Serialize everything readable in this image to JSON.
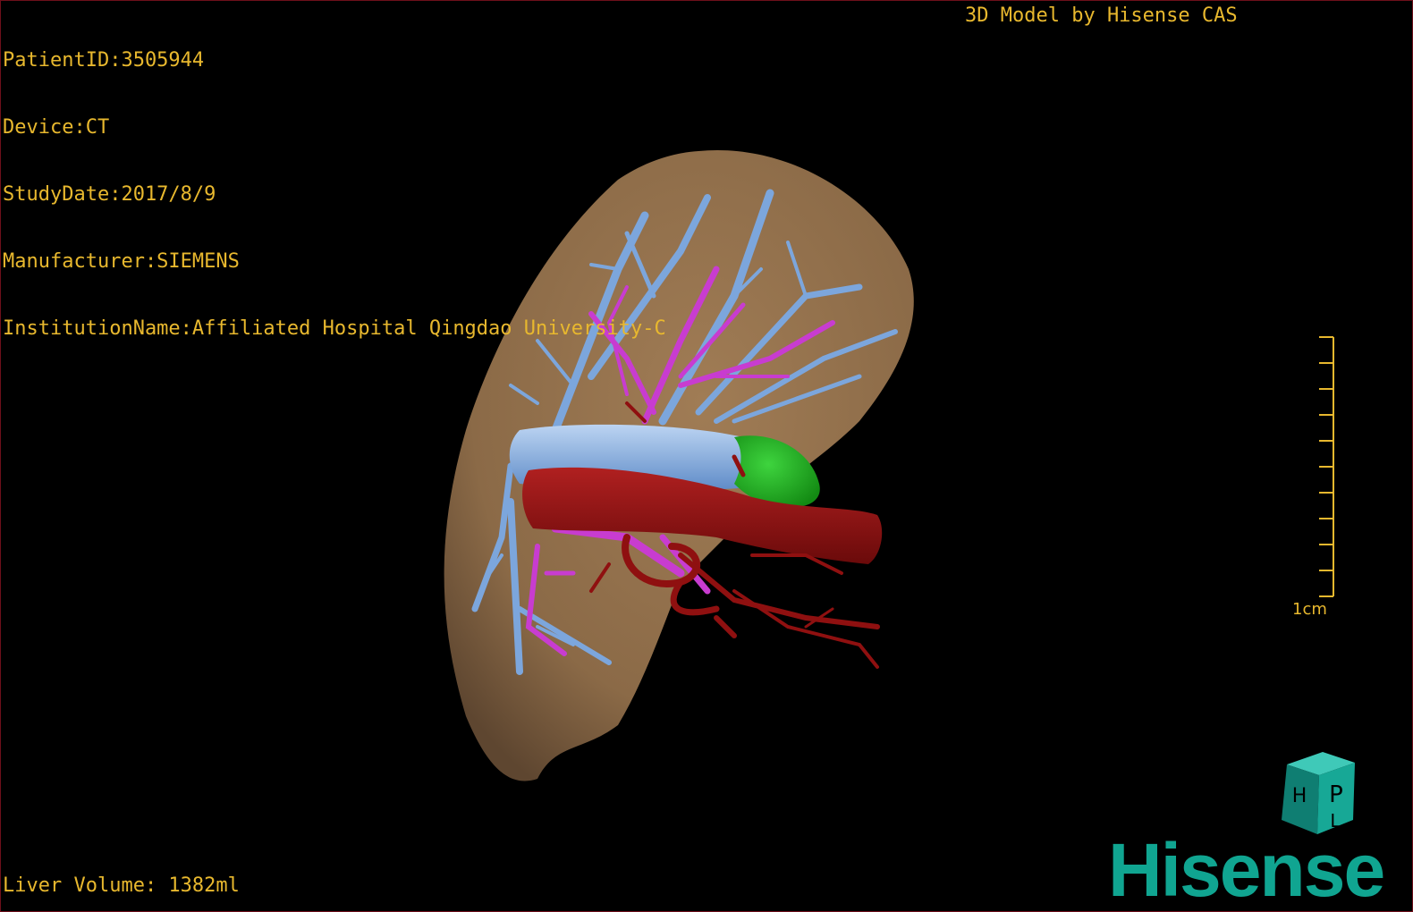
{
  "header": {
    "patient_id": "PatientID:3505944",
    "device": "Device:CT",
    "study_date": "StudyDate:2017/8/9",
    "manufacturer": "Manufacturer:SIEMENS",
    "institution": "InstitutionName:Affiliated Hospital Qingdao University-C",
    "credit": "3D Model by Hisense CAS"
  },
  "footer": {
    "liver_volume": "Liver Volume: 1382ml"
  },
  "scale": {
    "label": "1cm",
    "ticks": 10
  },
  "orientation_cube": {
    "faces": [
      "P",
      "H",
      "L"
    ]
  },
  "brand": {
    "name": "Hisense"
  },
  "model": {
    "structures": [
      "liver",
      "hepatic-veins",
      "portal-vein",
      "arteries",
      "gallbladder"
    ]
  },
  "colors": {
    "overlay_text": "#e8b82e",
    "liver": "#8b6a47",
    "hepatic_veins": "#7ca6dc",
    "portal_vein": "#c83cd0",
    "artery": "#8f1010",
    "gallbladder": "#1eb31e",
    "brand": "#10a591",
    "border": "#6e0f1a"
  }
}
